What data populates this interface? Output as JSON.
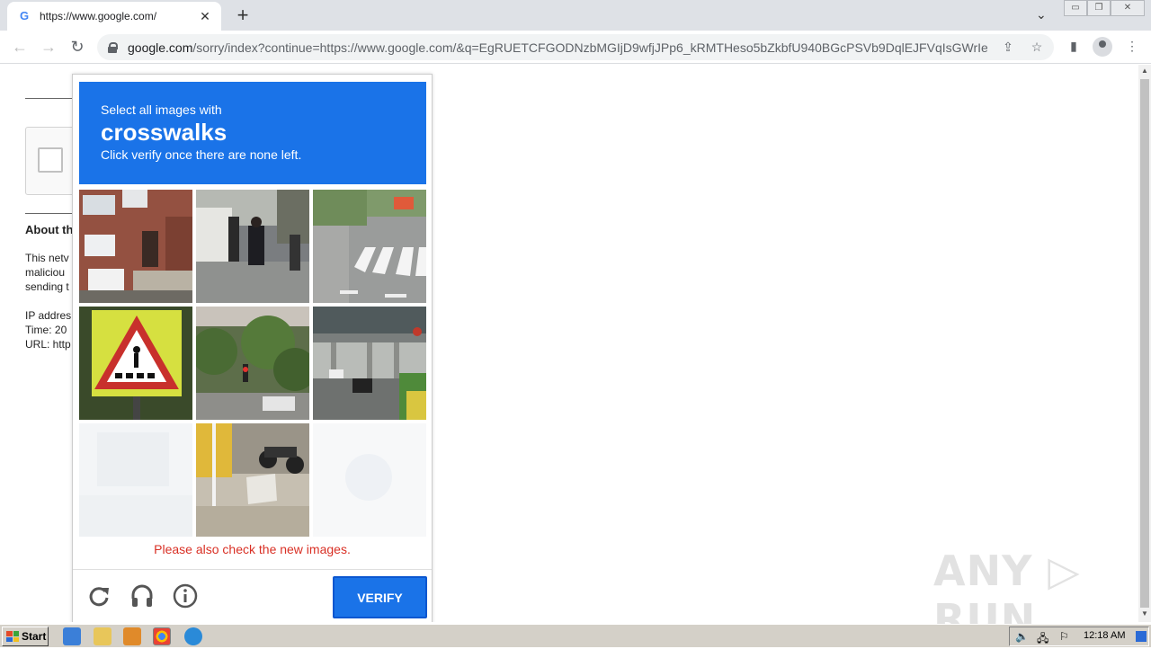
{
  "browser": {
    "tab_title": "https://www.google.com/",
    "tab_close": "✕",
    "new_tab": "+",
    "tab_search": "⌄",
    "url_host": "google.com",
    "url_rest": "/sorry/index?continue=https://www.google.com/&q=EgRUETCFGODNzbMGIjD9wfjJPp6_kRMTHeso5bZkbfU940BGcPSVb9DqlEJFVqIsGWrIeLui...",
    "nav": {
      "back": "←",
      "forward": "→",
      "reload": "↻"
    },
    "window_controls": {
      "minimize": "▭",
      "restore": "❐",
      "close": "✕"
    }
  },
  "background_page": {
    "about_heading": "About th",
    "lines": [
      "This netv",
      "maliciou",
      "sending t",
      "IP addres",
      "Time: 20",
      "URL: http"
    ]
  },
  "captcha": {
    "instruction": "Select all images with",
    "keyword": "crosswalks",
    "hint": "Click verify once there are none left.",
    "error": "Please also check the new images.",
    "verify_label": "VERIFY",
    "colors": {
      "header": "#1a73e8",
      "error": "#d93025"
    }
  },
  "taskbar": {
    "start_label": "Start",
    "clock": "12:18 AM"
  },
  "watermark": "ANY ▷ RUN"
}
